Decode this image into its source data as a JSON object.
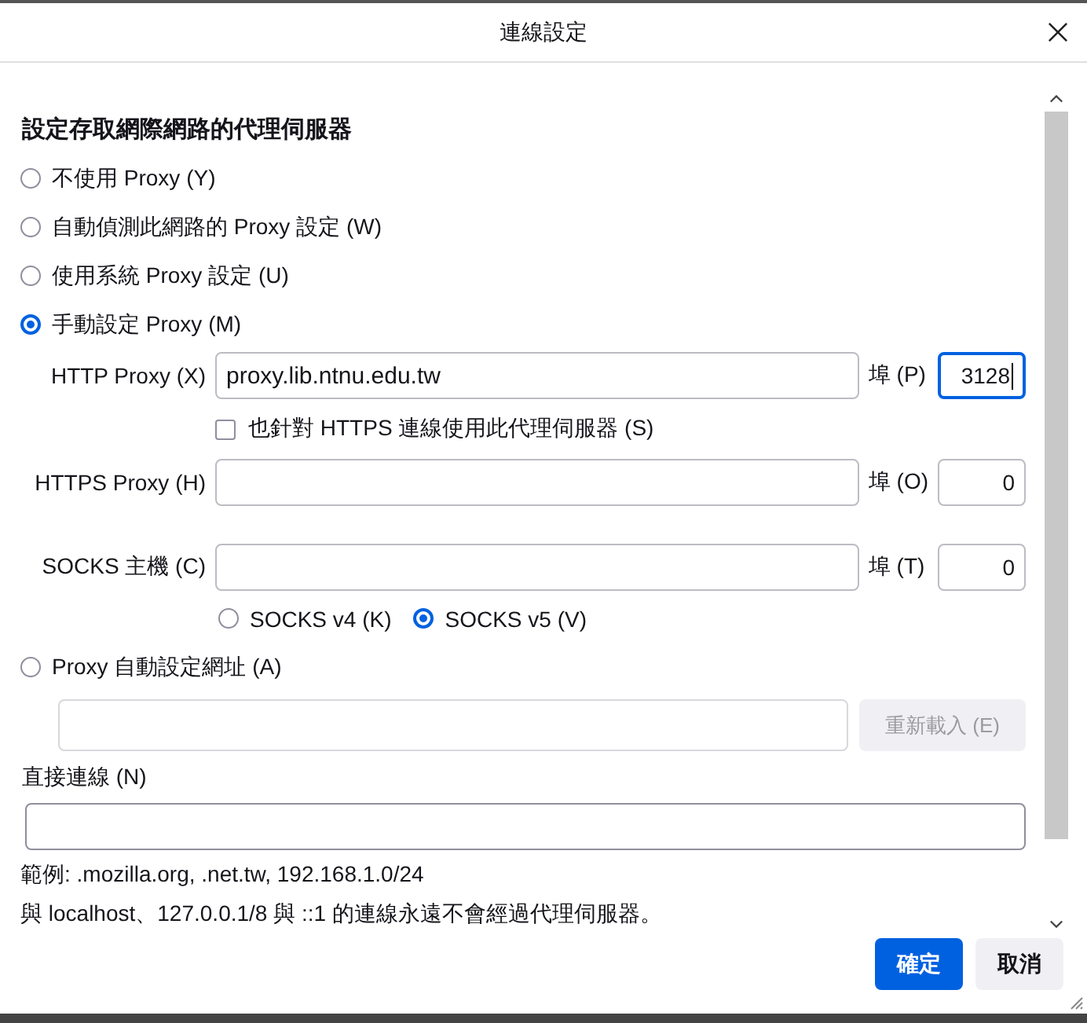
{
  "window": {
    "title": "連線設定"
  },
  "heading": "設定存取網際網路的代理伺服器",
  "proxy_modes": [
    {
      "label": "不使用 Proxy (Y)",
      "selected": false
    },
    {
      "label": "自動偵測此網路的 Proxy 設定 (W)",
      "selected": false
    },
    {
      "label": "使用系統 Proxy 設定 (U)",
      "selected": false
    },
    {
      "label": "手動設定 Proxy (M)",
      "selected": true
    },
    {
      "label": "Proxy 自動設定網址 (A)",
      "selected": false
    }
  ],
  "manual": {
    "http": {
      "label": "HTTP Proxy (X)",
      "value": "proxy.lib.ntnu.edu.tw",
      "port_label": "埠 (P)",
      "port": "3128",
      "port_focused": true
    },
    "also_https": {
      "label": "也針對 HTTPS 連線使用此代理伺服器 (S)",
      "checked": false
    },
    "https": {
      "label": "HTTPS Proxy (H)",
      "port_label": "埠 (O)",
      "port": "0",
      "port_focused": false
    },
    "socks": {
      "label": "SOCKS 主機 (C)",
      "port_label": "埠 (T)",
      "port": "0",
      "port_focused": false
    },
    "socks_versions": [
      {
        "label": "SOCKS v4 (K)",
        "selected": false
      },
      {
        "label": "SOCKS v5 (V)",
        "selected": true
      }
    ]
  },
  "auto_url": {
    "reload_button": {
      "label": "重新載入 (E)",
      "disabled": true
    }
  },
  "no_proxy": {
    "label": "直接連線 (N)"
  },
  "example": "範例: .mozilla.org, .net.tw, 192.168.1.0/24",
  "note": "與 localhost、127.0.0.1/8 與 ::1 的連線永遠不會經過代理伺服器。",
  "buttons": [
    {
      "label": "確定",
      "kind": "primary"
    },
    {
      "label": "取消",
      "kind": "secondary"
    }
  ]
}
